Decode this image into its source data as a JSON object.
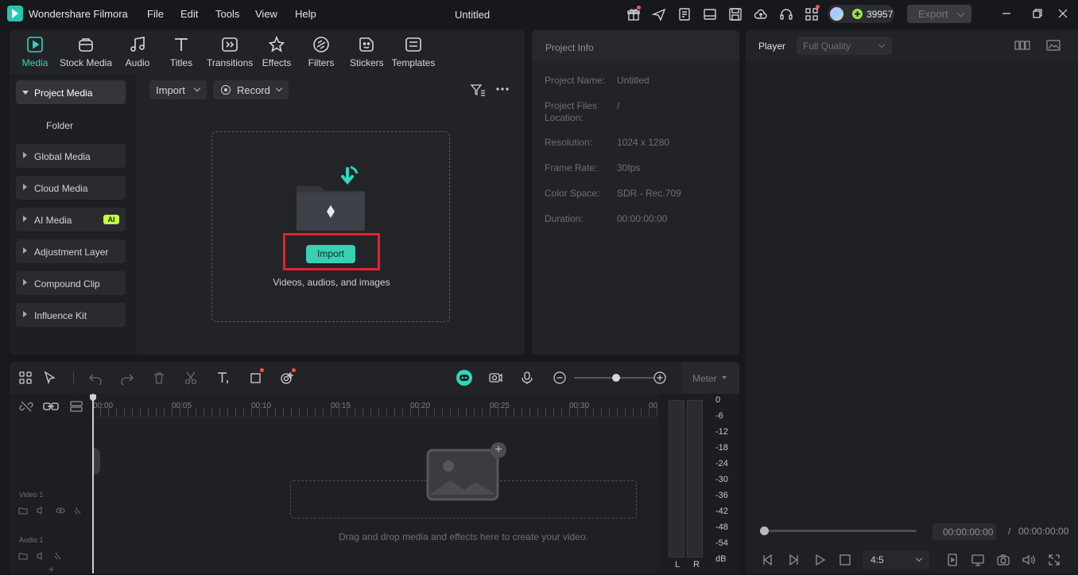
{
  "app": {
    "name": "Wondershare Filmora",
    "document_title": "Untitled",
    "menu": [
      "File",
      "Edit",
      "Tools",
      "View",
      "Help"
    ],
    "credits": "39957",
    "export_label": "Export"
  },
  "toolbar": {
    "tabs": [
      {
        "label": "Media",
        "icon": "media-icon",
        "active": true
      },
      {
        "label": "Stock Media",
        "icon": "stock-media-icon"
      },
      {
        "label": "Audio",
        "icon": "audio-icon"
      },
      {
        "label": "Titles",
        "icon": "titles-icon"
      },
      {
        "label": "Transitions",
        "icon": "transitions-icon"
      },
      {
        "label": "Effects",
        "icon": "effects-icon"
      },
      {
        "label": "Filters",
        "icon": "filters-icon"
      },
      {
        "label": "Stickers",
        "icon": "stickers-icon"
      },
      {
        "label": "Templates",
        "icon": "templates-icon"
      }
    ]
  },
  "sidebar": {
    "items": [
      {
        "label": "Project Media",
        "active": true
      },
      {
        "label": "Folder"
      },
      {
        "label": "Global Media"
      },
      {
        "label": "Cloud Media"
      },
      {
        "label": "AI Media",
        "badge": "AI"
      },
      {
        "label": "Adjustment Layer"
      },
      {
        "label": "Compound Clip"
      },
      {
        "label": "Influence Kit"
      }
    ]
  },
  "media": {
    "import_dropdown": "Import",
    "record_dropdown": "Record",
    "import_button": "Import",
    "hint": "Videos, audios, and images"
  },
  "project_info": {
    "title": "Project Info",
    "rows": [
      {
        "label": "Project Name:",
        "value": "Untitled"
      },
      {
        "label": "Project Files Location:",
        "value": "/"
      },
      {
        "label": "Resolution:",
        "value": "1024 x 1280"
      },
      {
        "label": "Frame Rate:",
        "value": "30fps"
      },
      {
        "label": "Color Space:",
        "value": "SDR - Rec.709"
      },
      {
        "label": "Duration:",
        "value": "00:00:00:00"
      }
    ]
  },
  "player": {
    "title": "Player",
    "quality": "Full Quality",
    "current_time": "00:00:00:00",
    "separator": "/",
    "total_time": "00:00:00:00",
    "aspect": "4:5",
    "progress": 0
  },
  "timeline": {
    "meter_label": "Meter",
    "ruler": [
      "00:00",
      "00:05",
      "00:10",
      "00:15",
      "00:20",
      "00:25",
      "00:30",
      "00:"
    ],
    "tracks": [
      "Video 1",
      "Audio 1"
    ],
    "drop_hint": "Drag and drop media and effects here to create your video.",
    "db_scale": [
      "0",
      "-6",
      "-12",
      "-18",
      "-24",
      "-30",
      "-36",
      "-42",
      "-48",
      "-54",
      "dB"
    ],
    "channels": [
      "L",
      "R"
    ],
    "zoom_level": 0.5
  },
  "colors": {
    "accent": "#2fd6bd",
    "highlight": "#e5202e",
    "background": "#18191c",
    "panel": "#222327"
  }
}
